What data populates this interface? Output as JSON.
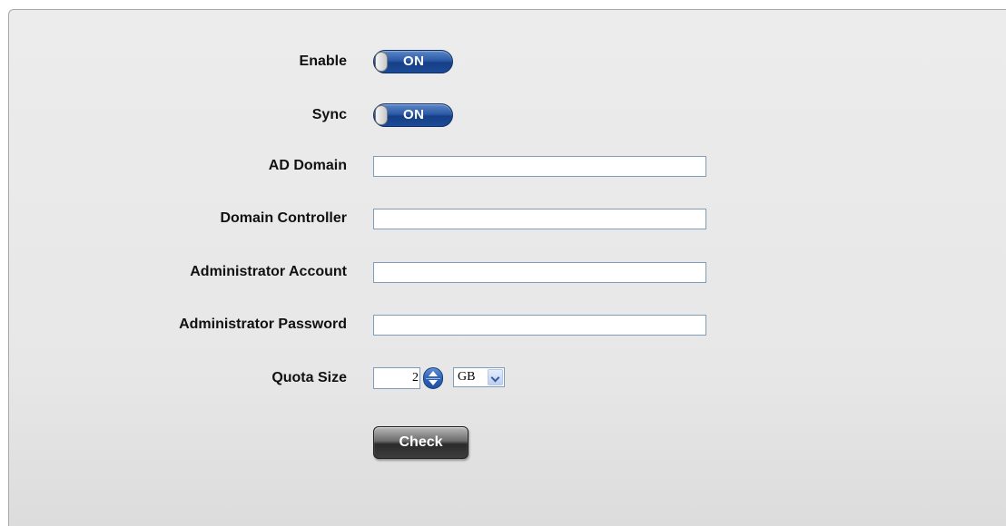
{
  "form": {
    "enable": {
      "label": "Enable",
      "toggle_text": "ON"
    },
    "sync": {
      "label": "Sync",
      "toggle_text": "ON"
    },
    "ad_domain": {
      "label": "AD Domain",
      "value": ""
    },
    "domain_controller": {
      "label": "Domain Controller",
      "value": ""
    },
    "admin_account": {
      "label": "Administrator Account",
      "value": ""
    },
    "admin_password": {
      "label": "Administrator Password",
      "value": ""
    },
    "quota": {
      "label": "Quota Size",
      "value": "2",
      "unit": "GB"
    },
    "check_label": "Check"
  },
  "colors": {
    "toggle_blue": "#1c4b98",
    "input_border": "#7f9db9",
    "panel_bg": "#e7e7e7"
  },
  "icons": {
    "spinner": "spin-up-down-icon",
    "select": "chevron-down-icon",
    "toggle": "toggle-knob-icon"
  }
}
